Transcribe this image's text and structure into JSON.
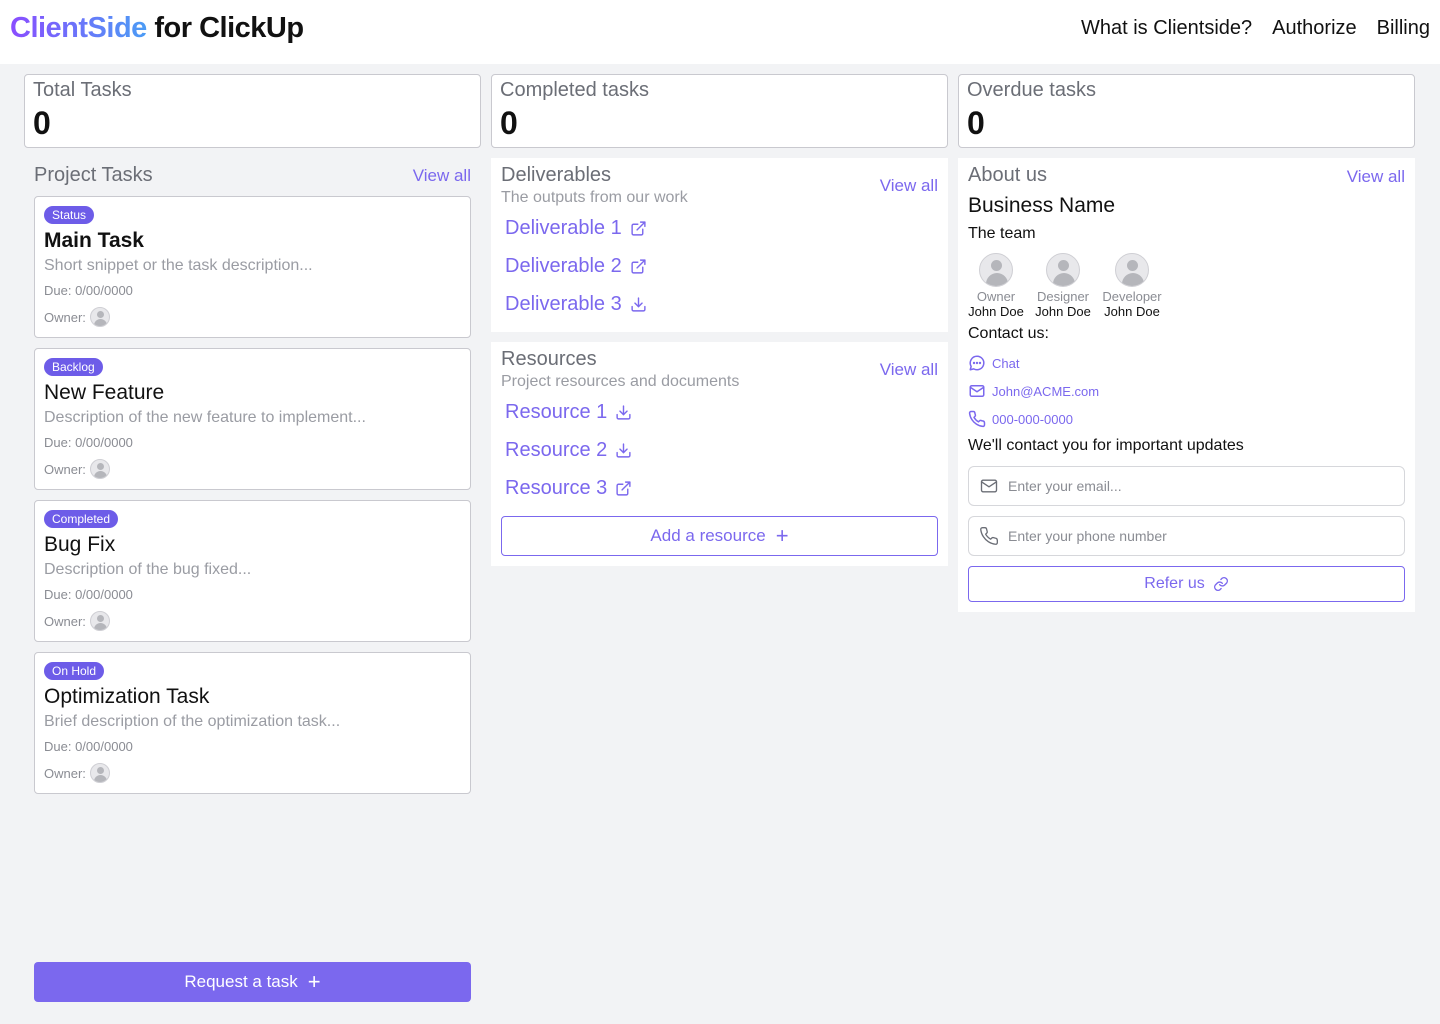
{
  "header": {
    "brand": "ClientSide",
    "brand_rest": " for ClickUp",
    "nav": [
      "What is Clientside?",
      "Authorize",
      "Billing"
    ]
  },
  "stats": [
    {
      "label": "Total Tasks",
      "value": "0"
    },
    {
      "label": "Completed tasks",
      "value": "0"
    },
    {
      "label": "Overdue tasks",
      "value": "0"
    }
  ],
  "project_tasks": {
    "title": "Project Tasks",
    "view_all": "View all",
    "tasks": [
      {
        "status": "Status",
        "title": "Main Task",
        "desc": "Short snippet or the task description...",
        "due": "Due: 0/00/0000",
        "owner_label": "Owner:"
      },
      {
        "status": "Backlog",
        "title": "New Feature",
        "desc": "Description of the new feature to implement...",
        "due": "Due: 0/00/0000",
        "owner_label": "Owner:"
      },
      {
        "status": "Completed",
        "title": "Bug Fix",
        "desc": "Description of the bug fixed...",
        "due": "Due: 0/00/0000",
        "owner_label": "Owner:"
      },
      {
        "status": "On Hold",
        "title": "Optimization Task",
        "desc": "Brief description of the optimization task...",
        "due": "Due: 0/00/0000",
        "owner_label": "Owner:"
      }
    ],
    "request_button": "Request a task"
  },
  "deliverables": {
    "title": "Deliverables",
    "subtitle": "The outputs from our work",
    "view_all": "View all",
    "items": [
      {
        "label": "Deliverable 1",
        "icon": "external-link-icon"
      },
      {
        "label": "Deliverable 2",
        "icon": "external-link-icon"
      },
      {
        "label": "Deliverable 3",
        "icon": "download-icon"
      }
    ]
  },
  "resources": {
    "title": "Resources",
    "subtitle": "Project resources and documents",
    "view_all": "View all",
    "items": [
      {
        "label": "Resource 1",
        "icon": "download-icon"
      },
      {
        "label": "Resource 2",
        "icon": "download-icon"
      },
      {
        "label": "Resource 3",
        "icon": "external-link-icon"
      }
    ],
    "add_button": "Add a resource"
  },
  "about": {
    "title": "About us",
    "view_all": "View all",
    "business_name": "Business Name",
    "team_label": "The team",
    "team": [
      {
        "role": "Owner",
        "name": "John Doe"
      },
      {
        "role": "Designer",
        "name": "John Doe"
      },
      {
        "role": "Developer",
        "name": "John Doe"
      }
    ],
    "contact_label": "Contact us:",
    "contacts": [
      {
        "label": "Chat",
        "icon": "chat-icon"
      },
      {
        "label": "John@ACME.com",
        "icon": "mail-icon"
      },
      {
        "label": "000-000-0000",
        "icon": "phone-icon"
      }
    ],
    "updates_label": "We'll contact you for important updates",
    "email_placeholder": "Enter your email...",
    "phone_placeholder": "Enter your phone number",
    "refer_button": "Refer us"
  },
  "colors": {
    "accent": "#7b68ee",
    "badge": "#6d5ce8",
    "background": "#f2f3f5"
  }
}
